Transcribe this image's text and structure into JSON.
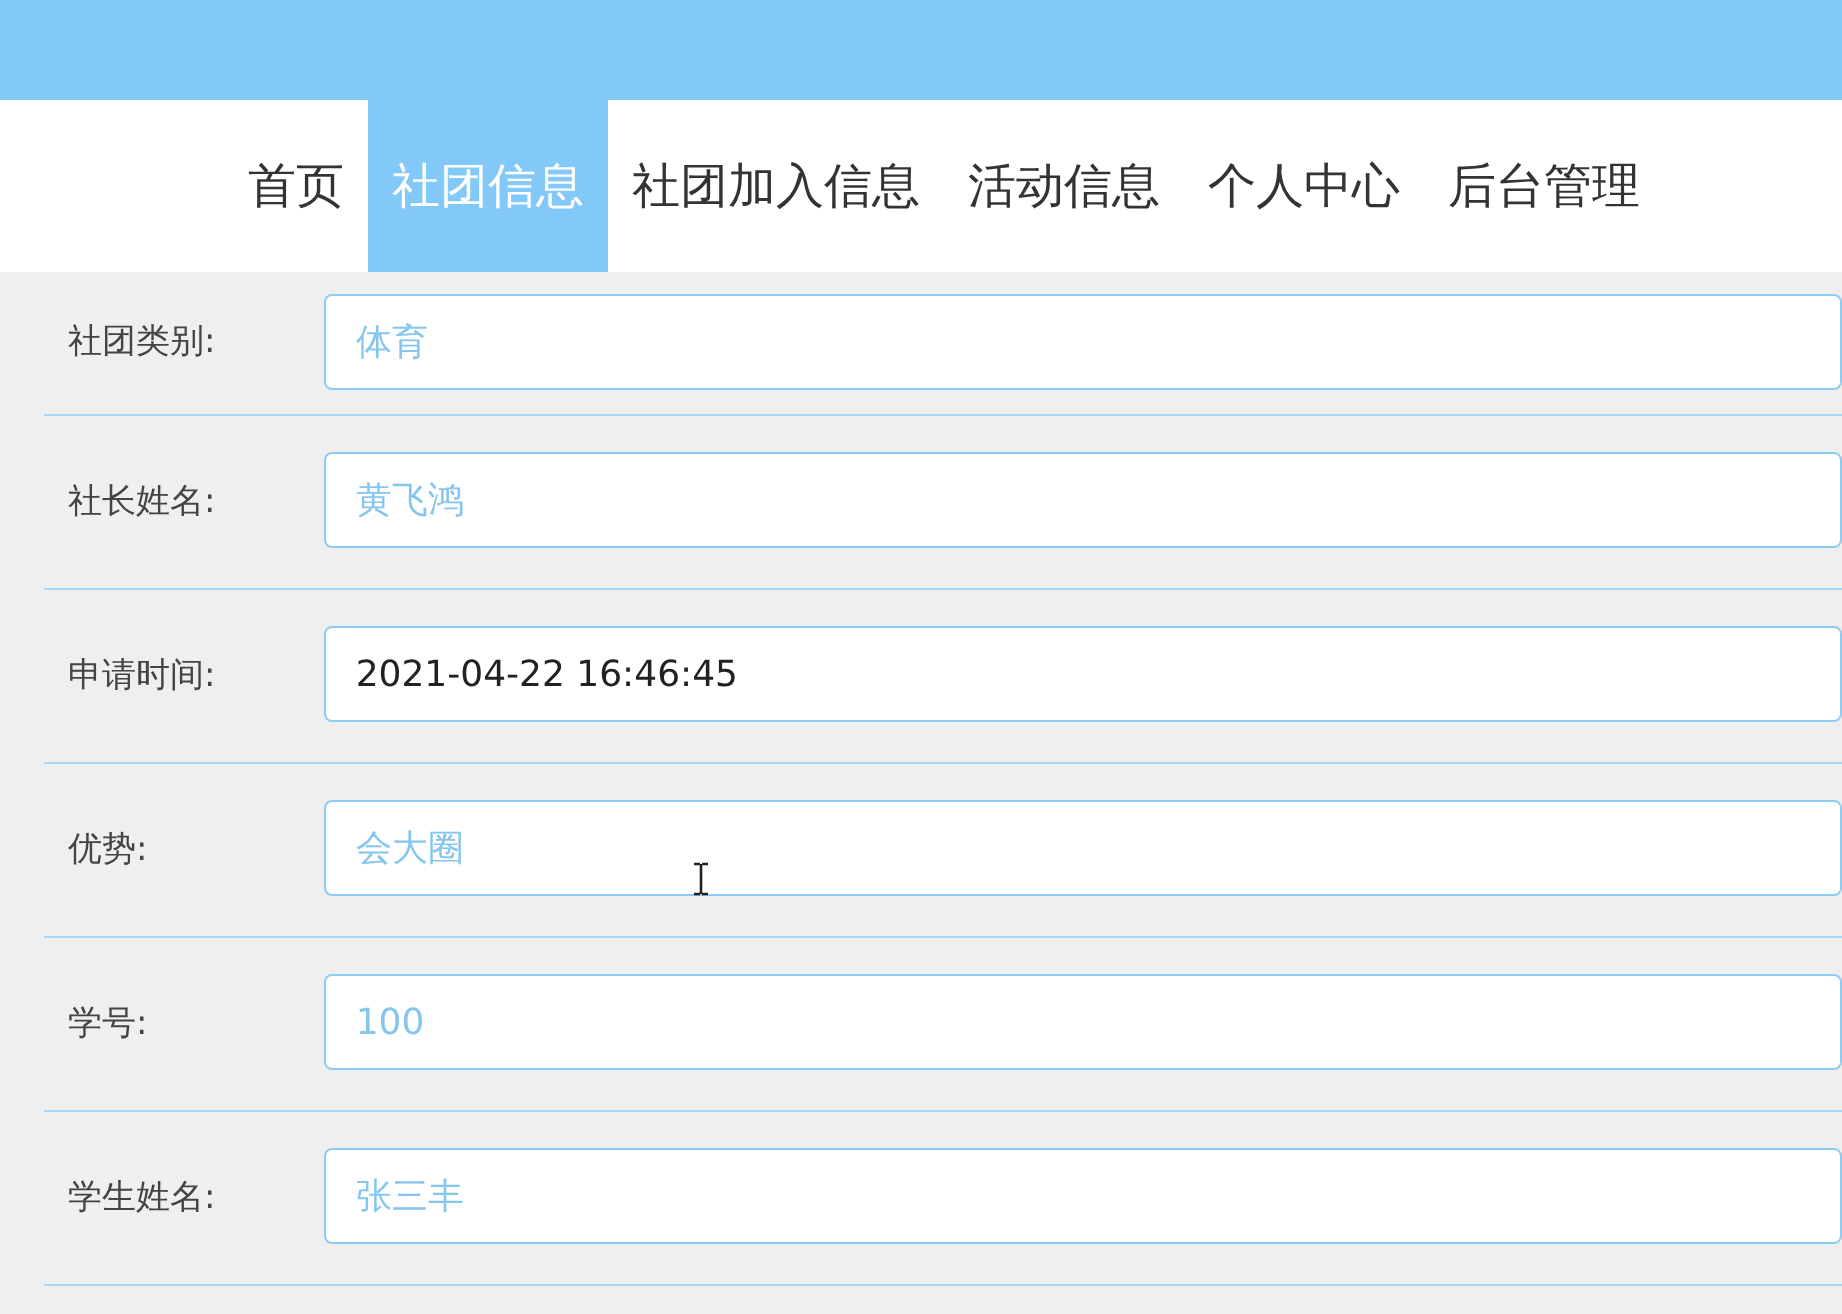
{
  "nav": {
    "items": [
      {
        "label": "首页",
        "selected": false
      },
      {
        "label": "社团信息",
        "selected": true
      },
      {
        "label": "社团加入信息",
        "selected": false
      },
      {
        "label": "活动信息",
        "selected": false
      },
      {
        "label": "个人中心",
        "selected": false
      },
      {
        "label": "后台管理",
        "selected": false
      }
    ]
  },
  "form": {
    "fields": [
      {
        "label": "社团类别:",
        "value": "体育",
        "kind": "text"
      },
      {
        "label": "社长姓名:",
        "value": "黄飞鸿",
        "kind": "text"
      },
      {
        "label": "申请时间:",
        "value": "2021-04-22 16:46:45",
        "kind": "datetime"
      },
      {
        "label": "优势:",
        "value": "会大圈",
        "kind": "text"
      },
      {
        "label": "学号:",
        "value": "100",
        "kind": "text"
      },
      {
        "label": "学生姓名:",
        "value": "张三丰",
        "kind": "text"
      }
    ]
  }
}
